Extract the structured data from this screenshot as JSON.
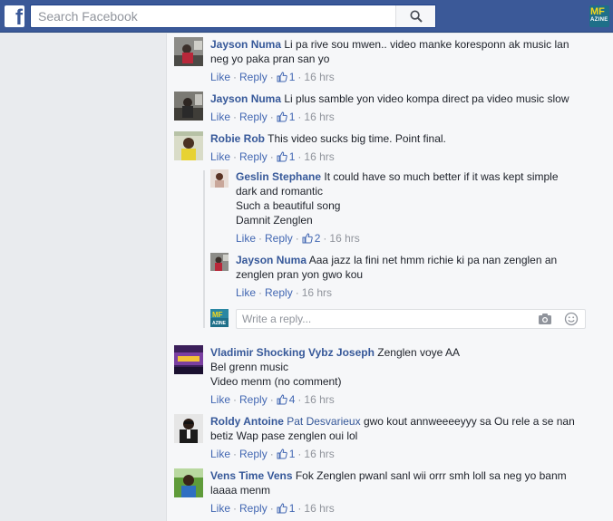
{
  "header": {
    "logo": "f",
    "search_placeholder": "Search Facebook",
    "profile_badge_top": "MF",
    "profile_badge_bottom": "AZINE",
    "icons": [
      "facebook-logo-icon",
      "search-icon",
      "profile-avatar-icon"
    ]
  },
  "comments": [
    {
      "author": "Jayson Numa",
      "lines": [
        "Li pa rive sou mwen.. video manke koresponn ak music lan",
        "neg yo paka pran san yo"
      ],
      "like": "Like",
      "reply": "Reply",
      "likes": "1",
      "time": "16 hrs"
    },
    {
      "author": "Jayson Numa",
      "lines": [
        "Li plus samble yon video kompa direct pa video music slow"
      ],
      "like": "Like",
      "reply": "Reply",
      "likes": "1",
      "time": "16 hrs"
    },
    {
      "author": "Robie Rob",
      "lines": [
        "This video sucks big time. Point final."
      ],
      "like": "Like",
      "reply": "Reply",
      "likes": "1",
      "time": "16 hrs"
    },
    {
      "author": "Vladimir Shocking Vybz Joseph",
      "lines": [
        "Zenglen voye AA",
        "Bel grenn music",
        "Video menm (no comment)"
      ],
      "like": "Like",
      "reply": "Reply",
      "likes": "4",
      "time": "16 hrs"
    },
    {
      "author": "Roldy Antoine",
      "mention": "Pat Desvarieux",
      "lines": [
        "gwo kout annweeeeyyy sa Ou rele a se nan",
        "betiz Wap pase zenglen oui lol"
      ],
      "like": "Like",
      "reply": "Reply",
      "likes": "1",
      "time": "16 hrs"
    },
    {
      "author": "Vens Time Vens",
      "lines": [
        "Fok Zenglen pwanl sanl wii orrr smh loll sa neg yo banm",
        "laaaa menm"
      ],
      "like": "Like",
      "reply": "Reply",
      "likes": "1",
      "time": "16 hrs"
    }
  ],
  "replies": [
    {
      "author": "Geslin Stephane",
      "lines": [
        "It could have so much better if it was kept simple",
        "dark and romantic",
        "Such a beautiful song",
        "Damnit Zenglen"
      ],
      "like": "Like",
      "reply": "Reply",
      "likes": "2",
      "time": "16 hrs"
    },
    {
      "author": "Jayson Numa",
      "lines": [
        "Aaa jazz la fini net hmm richie ki pa nan zenglen an",
        "zenglen pran yon gwo kou"
      ],
      "like": "Like",
      "reply": "Reply",
      "time": "16 hrs"
    }
  ],
  "reply_box": {
    "placeholder": "Write a reply...",
    "icons": [
      "camera-icon",
      "emoji-icon"
    ]
  },
  "colors": {
    "brand_blue": "#3b5998",
    "link_blue": "#365899",
    "action_blue": "#4267b2",
    "meta_gray": "#90949c",
    "panel_bg": "#f6f7f9"
  }
}
